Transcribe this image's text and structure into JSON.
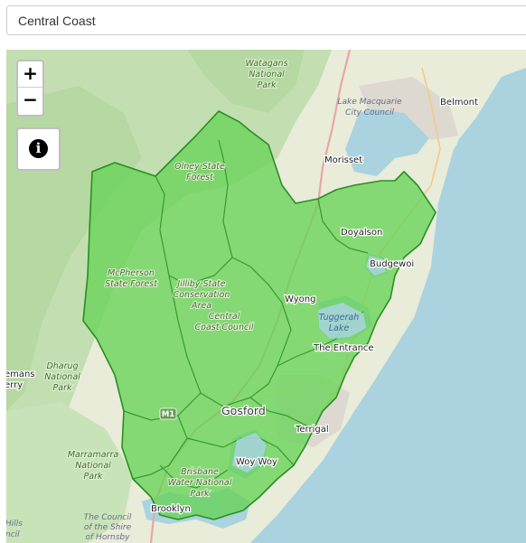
{
  "search": {
    "value": "Central Coast"
  },
  "map": {
    "colors": {
      "water": "#aad3df",
      "forest": "#add19e",
      "land": "#f2efe9",
      "region_fill": "#68d357",
      "region_stroke": "#2a8f21"
    },
    "controls": {
      "zoom_in": "+",
      "zoom_out": "−",
      "info_icon": "info-circle-icon",
      "info_glyph": "i"
    },
    "labels": {
      "watagans": [
        "Watagans",
        "National",
        "Park"
      ],
      "lake_macquarie": [
        "Lake Macquarie",
        "City Council"
      ],
      "belmont": "Belmont",
      "morisset": "Morisset",
      "olney": [
        "Olney State",
        "Forest"
      ],
      "doyalson": "Doyalson",
      "budgewoi": "Budgewoi",
      "mcpherson": [
        "McPherson",
        "State Forest"
      ],
      "jilliby": [
        "Jilliby State",
        "Conservation",
        "Area"
      ],
      "central_coast": [
        "Central",
        "Coast Council"
      ],
      "wyong": "Wyong",
      "tuggerah": [
        "Tuggerah",
        "Lake"
      ],
      "the_entrance": "The Entrance",
      "dharug": [
        "Dharug",
        "National",
        "Park"
      ],
      "emans_erry": [
        "emans",
        "erry"
      ],
      "m1": "M1",
      "gosford": "Gosford",
      "terrigal": "Terrigal",
      "marramarra": [
        "Marramarra",
        "National",
        "Park"
      ],
      "woy_woy": "Woy Woy",
      "brisbane_water": [
        "Brisbane",
        "Water National",
        "Park"
      ],
      "brooklyn": "Brooklyn",
      "hills": [
        "Hills",
        "ncil"
      ],
      "hornsby": [
        "The Council",
        "of the Shire",
        "of Hornsby"
      ]
    }
  }
}
